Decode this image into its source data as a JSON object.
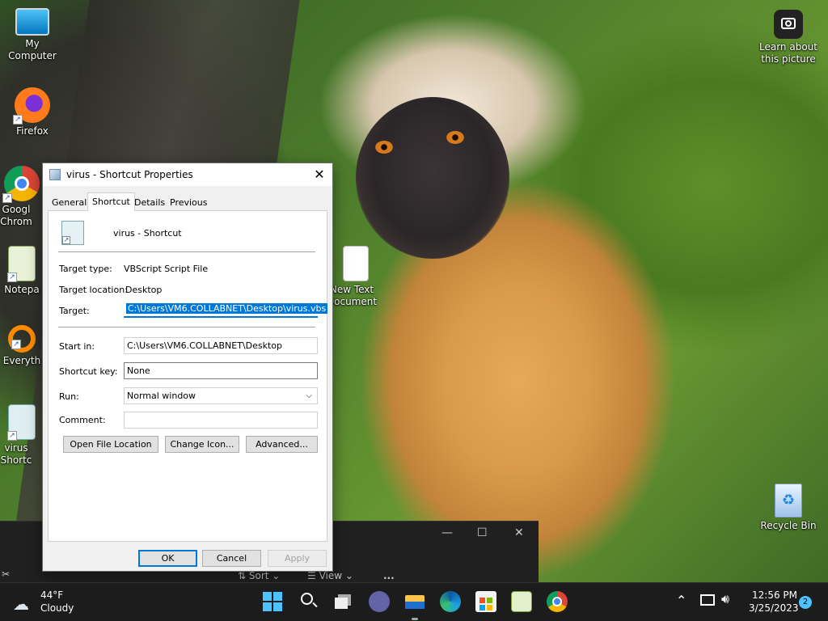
{
  "desktop": {
    "icons": [
      {
        "label": "My Computer"
      },
      {
        "label": "Firefox"
      },
      {
        "label": "Googl Chrom"
      },
      {
        "label": "Notepa"
      },
      {
        "label": "Everyth"
      },
      {
        "label": "virus Shortc"
      },
      {
        "label": "New Text Document"
      },
      {
        "label": "Recycle Bin"
      }
    ],
    "learn_about": "Learn about this picture"
  },
  "dialog": {
    "title": "virus - Shortcut Properties",
    "tabs": [
      "General",
      "Shortcut",
      "Details",
      "Previous Versions"
    ],
    "active_tab": "Shortcut",
    "shortcut_name": "virus - Shortcut",
    "target_type_label": "Target type:",
    "target_type_value": "VBScript Script File",
    "target_location_label": "Target location:",
    "target_location_value": "Desktop",
    "target_label": "Target:",
    "target_value": "C:\\Users\\VM6.COLLABNET\\Desktop\\virus.vbs",
    "start_in_label": "Start in:",
    "start_in_value": "C:\\Users\\VM6.COLLABNET\\Desktop",
    "shortcut_key_label": "Shortcut key:",
    "shortcut_key_value": "None",
    "run_label": "Run:",
    "run_value": "Normal window",
    "comment_label": "Comment:",
    "comment_value": "",
    "open_file_location": "Open File Location",
    "change_icon": "Change Icon...",
    "advanced": "Advanced...",
    "ok": "OK",
    "cancel": "Cancel",
    "apply": "Apply"
  },
  "explorer_bg": {
    "sort": "Sort",
    "view": "View",
    "more": "..."
  },
  "taskbar": {
    "weather_temp": "44°F",
    "weather_desc": "Cloudy",
    "time": "12:56 PM",
    "date": "3/25/2023",
    "notification_count": "2"
  },
  "colors": {
    "accent": "#0078d7",
    "taskbar_bg": "#1c1c1c",
    "dialog_bg": "#f0f0f0"
  }
}
